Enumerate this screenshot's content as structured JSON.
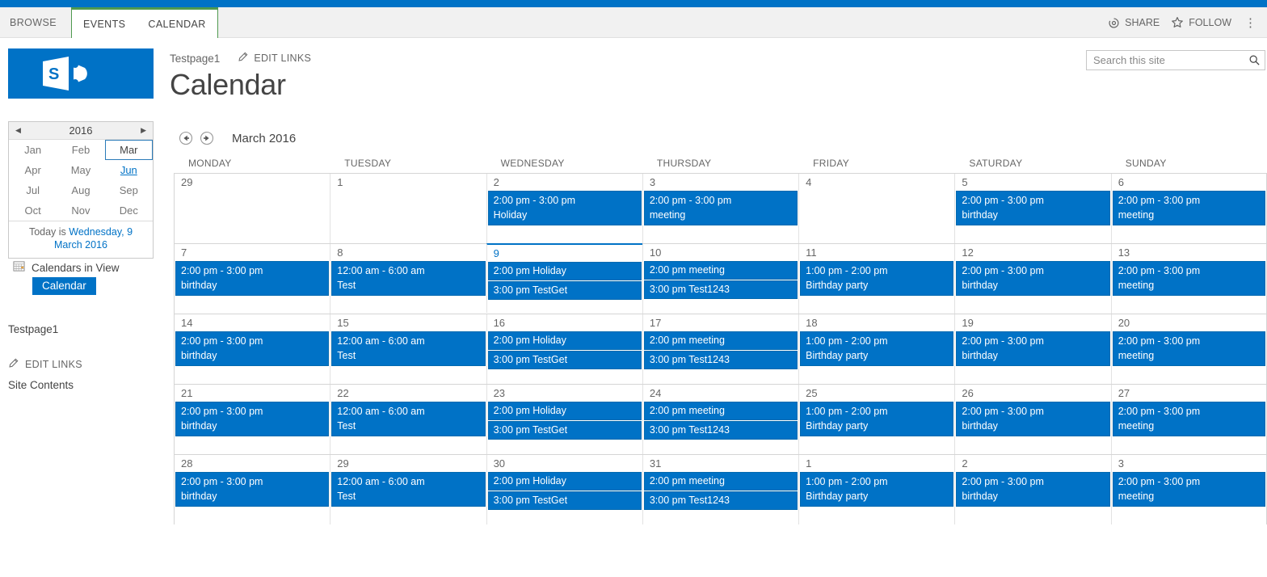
{
  "suite": {
    "bar_color": "#0072c6"
  },
  "ribbon": {
    "tabs": [
      {
        "label": "BROWSE",
        "group": false
      },
      {
        "label": "EVENTS",
        "group": true
      },
      {
        "label": "CALENDAR",
        "group": true
      }
    ],
    "share_label": "SHARE",
    "follow_label": "FOLLOW",
    "ellipsis": "⋮"
  },
  "header": {
    "breadcrumb": "Testpage1",
    "edit_links_label": "EDIT LINKS",
    "title": "Calendar",
    "logo_alt": "sharepoint-logo"
  },
  "search": {
    "placeholder": "Search this site",
    "value": ""
  },
  "minicalendar": {
    "year": "2016",
    "prev_arrow": "◀",
    "next_arrow": "▶",
    "months": [
      {
        "label": "Jan",
        "state": "normal"
      },
      {
        "label": "Feb",
        "state": "normal"
      },
      {
        "label": "Mar",
        "state": "selected"
      },
      {
        "label": "Apr",
        "state": "normal"
      },
      {
        "label": "May",
        "state": "normal"
      },
      {
        "label": "Jun",
        "state": "hover"
      },
      {
        "label": "Jul",
        "state": "normal"
      },
      {
        "label": "Aug",
        "state": "normal"
      },
      {
        "label": "Sep",
        "state": "normal"
      },
      {
        "label": "Oct",
        "state": "normal"
      },
      {
        "label": "Nov",
        "state": "normal"
      },
      {
        "label": "Dec",
        "state": "normal"
      }
    ],
    "today_prefix": "Today is ",
    "today_link": "Wednesday, 9 March 2016"
  },
  "sidebar": {
    "calendars_in_view_label": "Calendars in View",
    "calendar_chip": "Calendar",
    "quicklaunch": [
      {
        "label": "Testpage1",
        "type": "link"
      }
    ],
    "edit_links_label": "EDIT LINKS",
    "site_contents_label": "Site Contents"
  },
  "calendar": {
    "month_label": "March 2016",
    "prev_title": "previous",
    "next_title": "next",
    "day_headers": [
      "MONDAY",
      "TUESDAY",
      "WEDNESDAY",
      "THURSDAY",
      "FRIDAY",
      "SATURDAY",
      "SUNDAY"
    ],
    "accent_color": "#0072c6",
    "weeks": [
      [
        {
          "num": "29",
          "today": false,
          "events": []
        },
        {
          "num": "1",
          "today": false,
          "events": []
        },
        {
          "num": "2",
          "today": false,
          "events": [
            {
              "time": "2:00 pm - 3:00 pm",
              "title": "Holiday",
              "style": "two-line"
            }
          ]
        },
        {
          "num": "3",
          "today": false,
          "events": [
            {
              "time": "2:00 pm - 3:00 pm",
              "title": "meeting",
              "style": "two-line"
            }
          ]
        },
        {
          "num": "4",
          "today": false,
          "events": []
        },
        {
          "num": "5",
          "today": false,
          "events": [
            {
              "time": "2:00 pm - 3:00 pm",
              "title": "birthday",
              "style": "two-line"
            }
          ]
        },
        {
          "num": "6",
          "today": false,
          "events": [
            {
              "time": "2:00 pm - 3:00 pm",
              "title": "meeting",
              "style": "two-line"
            }
          ]
        }
      ],
      [
        {
          "num": "7",
          "today": false,
          "events": [
            {
              "time": "2:00 pm - 3:00 pm",
              "title": "birthday",
              "style": "two-line"
            }
          ]
        },
        {
          "num": "8",
          "today": false,
          "events": [
            {
              "time": "12:00 am - 6:00 am",
              "title": "Test",
              "style": "two-line"
            }
          ]
        },
        {
          "num": "9",
          "today": true,
          "events": [
            {
              "time": "2:00 pm",
              "title": "Holiday",
              "style": "one-line"
            },
            {
              "time": "3:00 pm",
              "title": "TestGet",
              "style": "one-line"
            }
          ]
        },
        {
          "num": "10",
          "today": false,
          "events": [
            {
              "time": "2:00 pm",
              "title": "meeting",
              "style": "one-line"
            },
            {
              "time": "3:00 pm",
              "title": "Test1243",
              "style": "one-line"
            }
          ]
        },
        {
          "num": "11",
          "today": false,
          "events": [
            {
              "time": "1:00 pm - 2:00 pm",
              "title": "Birthday party",
              "style": "two-line"
            }
          ]
        },
        {
          "num": "12",
          "today": false,
          "events": [
            {
              "time": "2:00 pm - 3:00 pm",
              "title": "birthday",
              "style": "two-line"
            }
          ]
        },
        {
          "num": "13",
          "today": false,
          "events": [
            {
              "time": "2:00 pm - 3:00 pm",
              "title": "meeting",
              "style": "two-line"
            }
          ]
        }
      ],
      [
        {
          "num": "14",
          "today": false,
          "events": [
            {
              "time": "2:00 pm - 3:00 pm",
              "title": "birthday",
              "style": "two-line"
            }
          ]
        },
        {
          "num": "15",
          "today": false,
          "events": [
            {
              "time": "12:00 am - 6:00 am",
              "title": "Test",
              "style": "two-line"
            }
          ]
        },
        {
          "num": "16",
          "today": false,
          "events": [
            {
              "time": "2:00 pm",
              "title": "Holiday",
              "style": "one-line"
            },
            {
              "time": "3:00 pm",
              "title": "TestGet",
              "style": "one-line"
            }
          ]
        },
        {
          "num": "17",
          "today": false,
          "events": [
            {
              "time": "2:00 pm",
              "title": "meeting",
              "style": "one-line"
            },
            {
              "time": "3:00 pm",
              "title": "Test1243",
              "style": "one-line"
            }
          ]
        },
        {
          "num": "18",
          "today": false,
          "events": [
            {
              "time": "1:00 pm - 2:00 pm",
              "title": "Birthday party",
              "style": "two-line"
            }
          ]
        },
        {
          "num": "19",
          "today": false,
          "events": [
            {
              "time": "2:00 pm - 3:00 pm",
              "title": "birthday",
              "style": "two-line"
            }
          ]
        },
        {
          "num": "20",
          "today": false,
          "events": [
            {
              "time": "2:00 pm - 3:00 pm",
              "title": "meeting",
              "style": "two-line"
            }
          ]
        }
      ],
      [
        {
          "num": "21",
          "today": false,
          "events": [
            {
              "time": "2:00 pm - 3:00 pm",
              "title": "birthday",
              "style": "two-line"
            }
          ]
        },
        {
          "num": "22",
          "today": false,
          "events": [
            {
              "time": "12:00 am - 6:00 am",
              "title": "Test",
              "style": "two-line"
            }
          ]
        },
        {
          "num": "23",
          "today": false,
          "events": [
            {
              "time": "2:00 pm",
              "title": "Holiday",
              "style": "one-line"
            },
            {
              "time": "3:00 pm",
              "title": "TestGet",
              "style": "one-line"
            }
          ]
        },
        {
          "num": "24",
          "today": false,
          "events": [
            {
              "time": "2:00 pm",
              "title": "meeting",
              "style": "one-line"
            },
            {
              "time": "3:00 pm",
              "title": "Test1243",
              "style": "one-line"
            }
          ]
        },
        {
          "num": "25",
          "today": false,
          "events": [
            {
              "time": "1:00 pm - 2:00 pm",
              "title": "Birthday party",
              "style": "two-line"
            }
          ]
        },
        {
          "num": "26",
          "today": false,
          "events": [
            {
              "time": "2:00 pm - 3:00 pm",
              "title": "birthday",
              "style": "two-line"
            }
          ]
        },
        {
          "num": "27",
          "today": false,
          "events": [
            {
              "time": "2:00 pm - 3:00 pm",
              "title": "meeting",
              "style": "two-line"
            }
          ]
        }
      ],
      [
        {
          "num": "28",
          "today": false,
          "events": [
            {
              "time": "2:00 pm - 3:00 pm",
              "title": "birthday",
              "style": "two-line"
            }
          ]
        },
        {
          "num": "29",
          "today": false,
          "events": [
            {
              "time": "12:00 am - 6:00 am",
              "title": "Test",
              "style": "two-line"
            }
          ]
        },
        {
          "num": "30",
          "today": false,
          "events": [
            {
              "time": "2:00 pm",
              "title": "Holiday",
              "style": "one-line"
            },
            {
              "time": "3:00 pm",
              "title": "TestGet",
              "style": "one-line"
            }
          ]
        },
        {
          "num": "31",
          "today": false,
          "events": [
            {
              "time": "2:00 pm",
              "title": "meeting",
              "style": "one-line"
            },
            {
              "time": "3:00 pm",
              "title": "Test1243",
              "style": "one-line"
            }
          ]
        },
        {
          "num": "1",
          "today": false,
          "events": [
            {
              "time": "1:00 pm - 2:00 pm",
              "title": "Birthday party",
              "style": "two-line"
            }
          ]
        },
        {
          "num": "2",
          "today": false,
          "events": [
            {
              "time": "2:00 pm - 3:00 pm",
              "title": "birthday",
              "style": "two-line"
            }
          ]
        },
        {
          "num": "3",
          "today": false,
          "events": [
            {
              "time": "2:00 pm - 3:00 pm",
              "title": "meeting",
              "style": "two-line"
            }
          ]
        }
      ]
    ]
  }
}
